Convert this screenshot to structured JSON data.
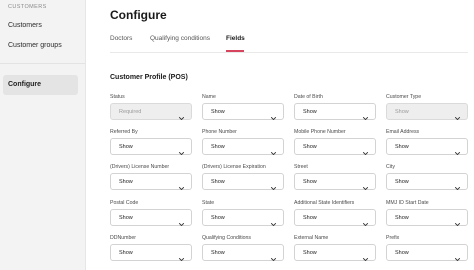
{
  "sidebar": {
    "section_label": "CUSTOMERS",
    "items": [
      {
        "label": "Customers"
      },
      {
        "label": "Customer groups"
      }
    ],
    "active_item": {
      "label": "Configure"
    }
  },
  "page": {
    "title": "Configure",
    "section_title": "Customer Profile (POS)"
  },
  "tabs": [
    {
      "label": "Doctors"
    },
    {
      "label": "Qualifying conditions"
    },
    {
      "label": "Fields"
    }
  ],
  "active_tab": "Fields",
  "colors": {
    "accent": "#d6455d",
    "sidebar_bg": "#f3f3f3",
    "disabled_bg": "#eeeeee"
  },
  "fields": [
    {
      "label": "Status",
      "value": "Required",
      "disabled": true
    },
    {
      "label": "Name",
      "value": "Show",
      "disabled": false
    },
    {
      "label": "Date of Birth",
      "value": "Show",
      "disabled": false
    },
    {
      "label": "Customer Type",
      "value": "Show",
      "disabled": true
    },
    {
      "label": "Referred By",
      "value": "Show",
      "disabled": false
    },
    {
      "label": "Phone Number",
      "value": "Show",
      "disabled": false
    },
    {
      "label": "Mobile Phone Number",
      "value": "Show",
      "disabled": false
    },
    {
      "label": "Email Address",
      "value": "Show",
      "disabled": false
    },
    {
      "label": "(Drivers) License Number",
      "value": "Show",
      "disabled": false
    },
    {
      "label": "(Drivers) License Expiration",
      "value": "Show",
      "disabled": false
    },
    {
      "label": "Street",
      "value": "Show",
      "disabled": false
    },
    {
      "label": "City",
      "value": "Show",
      "disabled": false
    },
    {
      "label": "Postal Code",
      "value": "Show",
      "disabled": false
    },
    {
      "label": "State",
      "value": "Show",
      "disabled": false
    },
    {
      "label": "Additional State Identifiers",
      "value": "Show",
      "disabled": false
    },
    {
      "label": "MMJ ID Start Date",
      "value": "Show",
      "disabled": false
    },
    {
      "label": "DDNumber",
      "value": "Show",
      "disabled": false
    },
    {
      "label": "Qualifying Conditions",
      "value": "Show",
      "disabled": false
    },
    {
      "label": "External Name",
      "value": "Show",
      "disabled": false
    },
    {
      "label": "Prefix",
      "value": "Show",
      "disabled": false
    }
  ]
}
